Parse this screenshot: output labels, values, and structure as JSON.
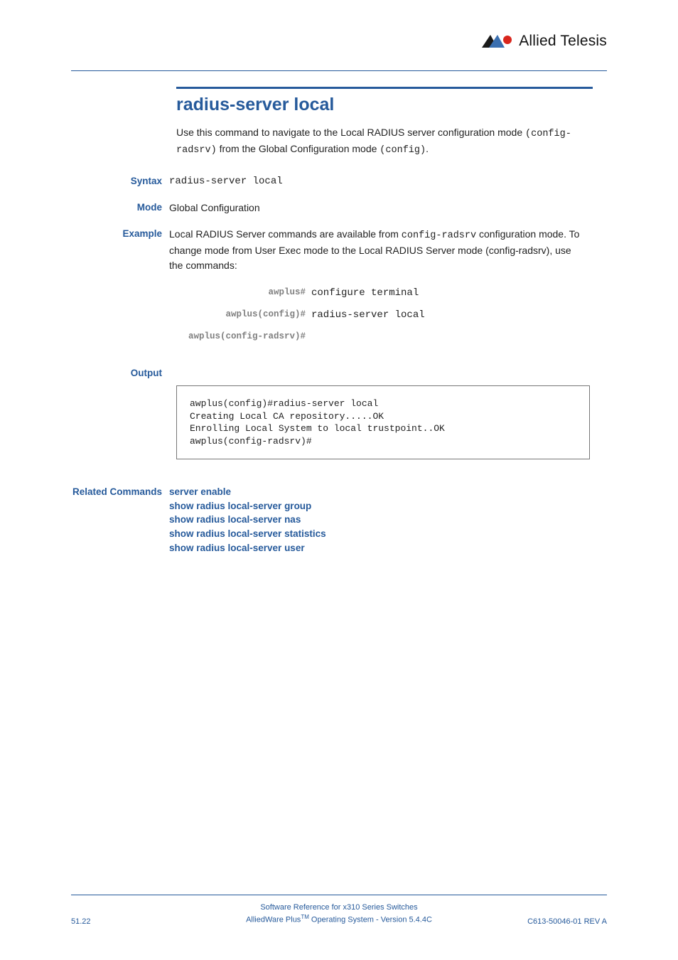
{
  "brand": {
    "name": "Allied Telesis"
  },
  "title": "radius-server local",
  "intro": {
    "pre": "Use this command to navigate to the Local RADIUS server configuration mode ",
    "code1": "(config-radsrv)",
    "mid": " from the Global Configuration mode ",
    "code2": "(config)",
    "post": "."
  },
  "sections": {
    "syntax_label": "Syntax",
    "syntax_value": "radius-server local",
    "mode_label": "Mode",
    "mode_value": "Global Configuration",
    "example_label": "Example",
    "example_pre": "Local RADIUS Server commands are available from ",
    "example_code": "config-radsrv",
    "example_post": " configuration mode. To change mode from User Exec mode to the Local RADIUS Server mode (config-radsrv), use the commands:",
    "cli": [
      {
        "prompt": "awplus#",
        "cmd": "configure terminal"
      },
      {
        "prompt": "awplus(config)#",
        "cmd": "radius-server local"
      },
      {
        "prompt": "awplus(config-radsrv)#",
        "cmd": ""
      }
    ],
    "output_label": "Output",
    "output_text": "awplus(config)#radius-server local\nCreating Local CA repository.....OK\nEnrolling Local System to local trustpoint..OK\nawplus(config-radsrv)#",
    "related_label": "Related Commands",
    "related_links": [
      "server enable",
      "show radius local-server group",
      "show radius local-server nas",
      "show radius local-server statistics",
      "show radius local-server user"
    ]
  },
  "footer": {
    "line1": "Software Reference for x310 Series Switches",
    "line2_pre": "AlliedWare Plus",
    "line2_tm": "TM",
    "line2_post": " Operating System  - Version 5.4.4C",
    "page": "51.22",
    "rev": "C613-50046-01 REV A"
  }
}
